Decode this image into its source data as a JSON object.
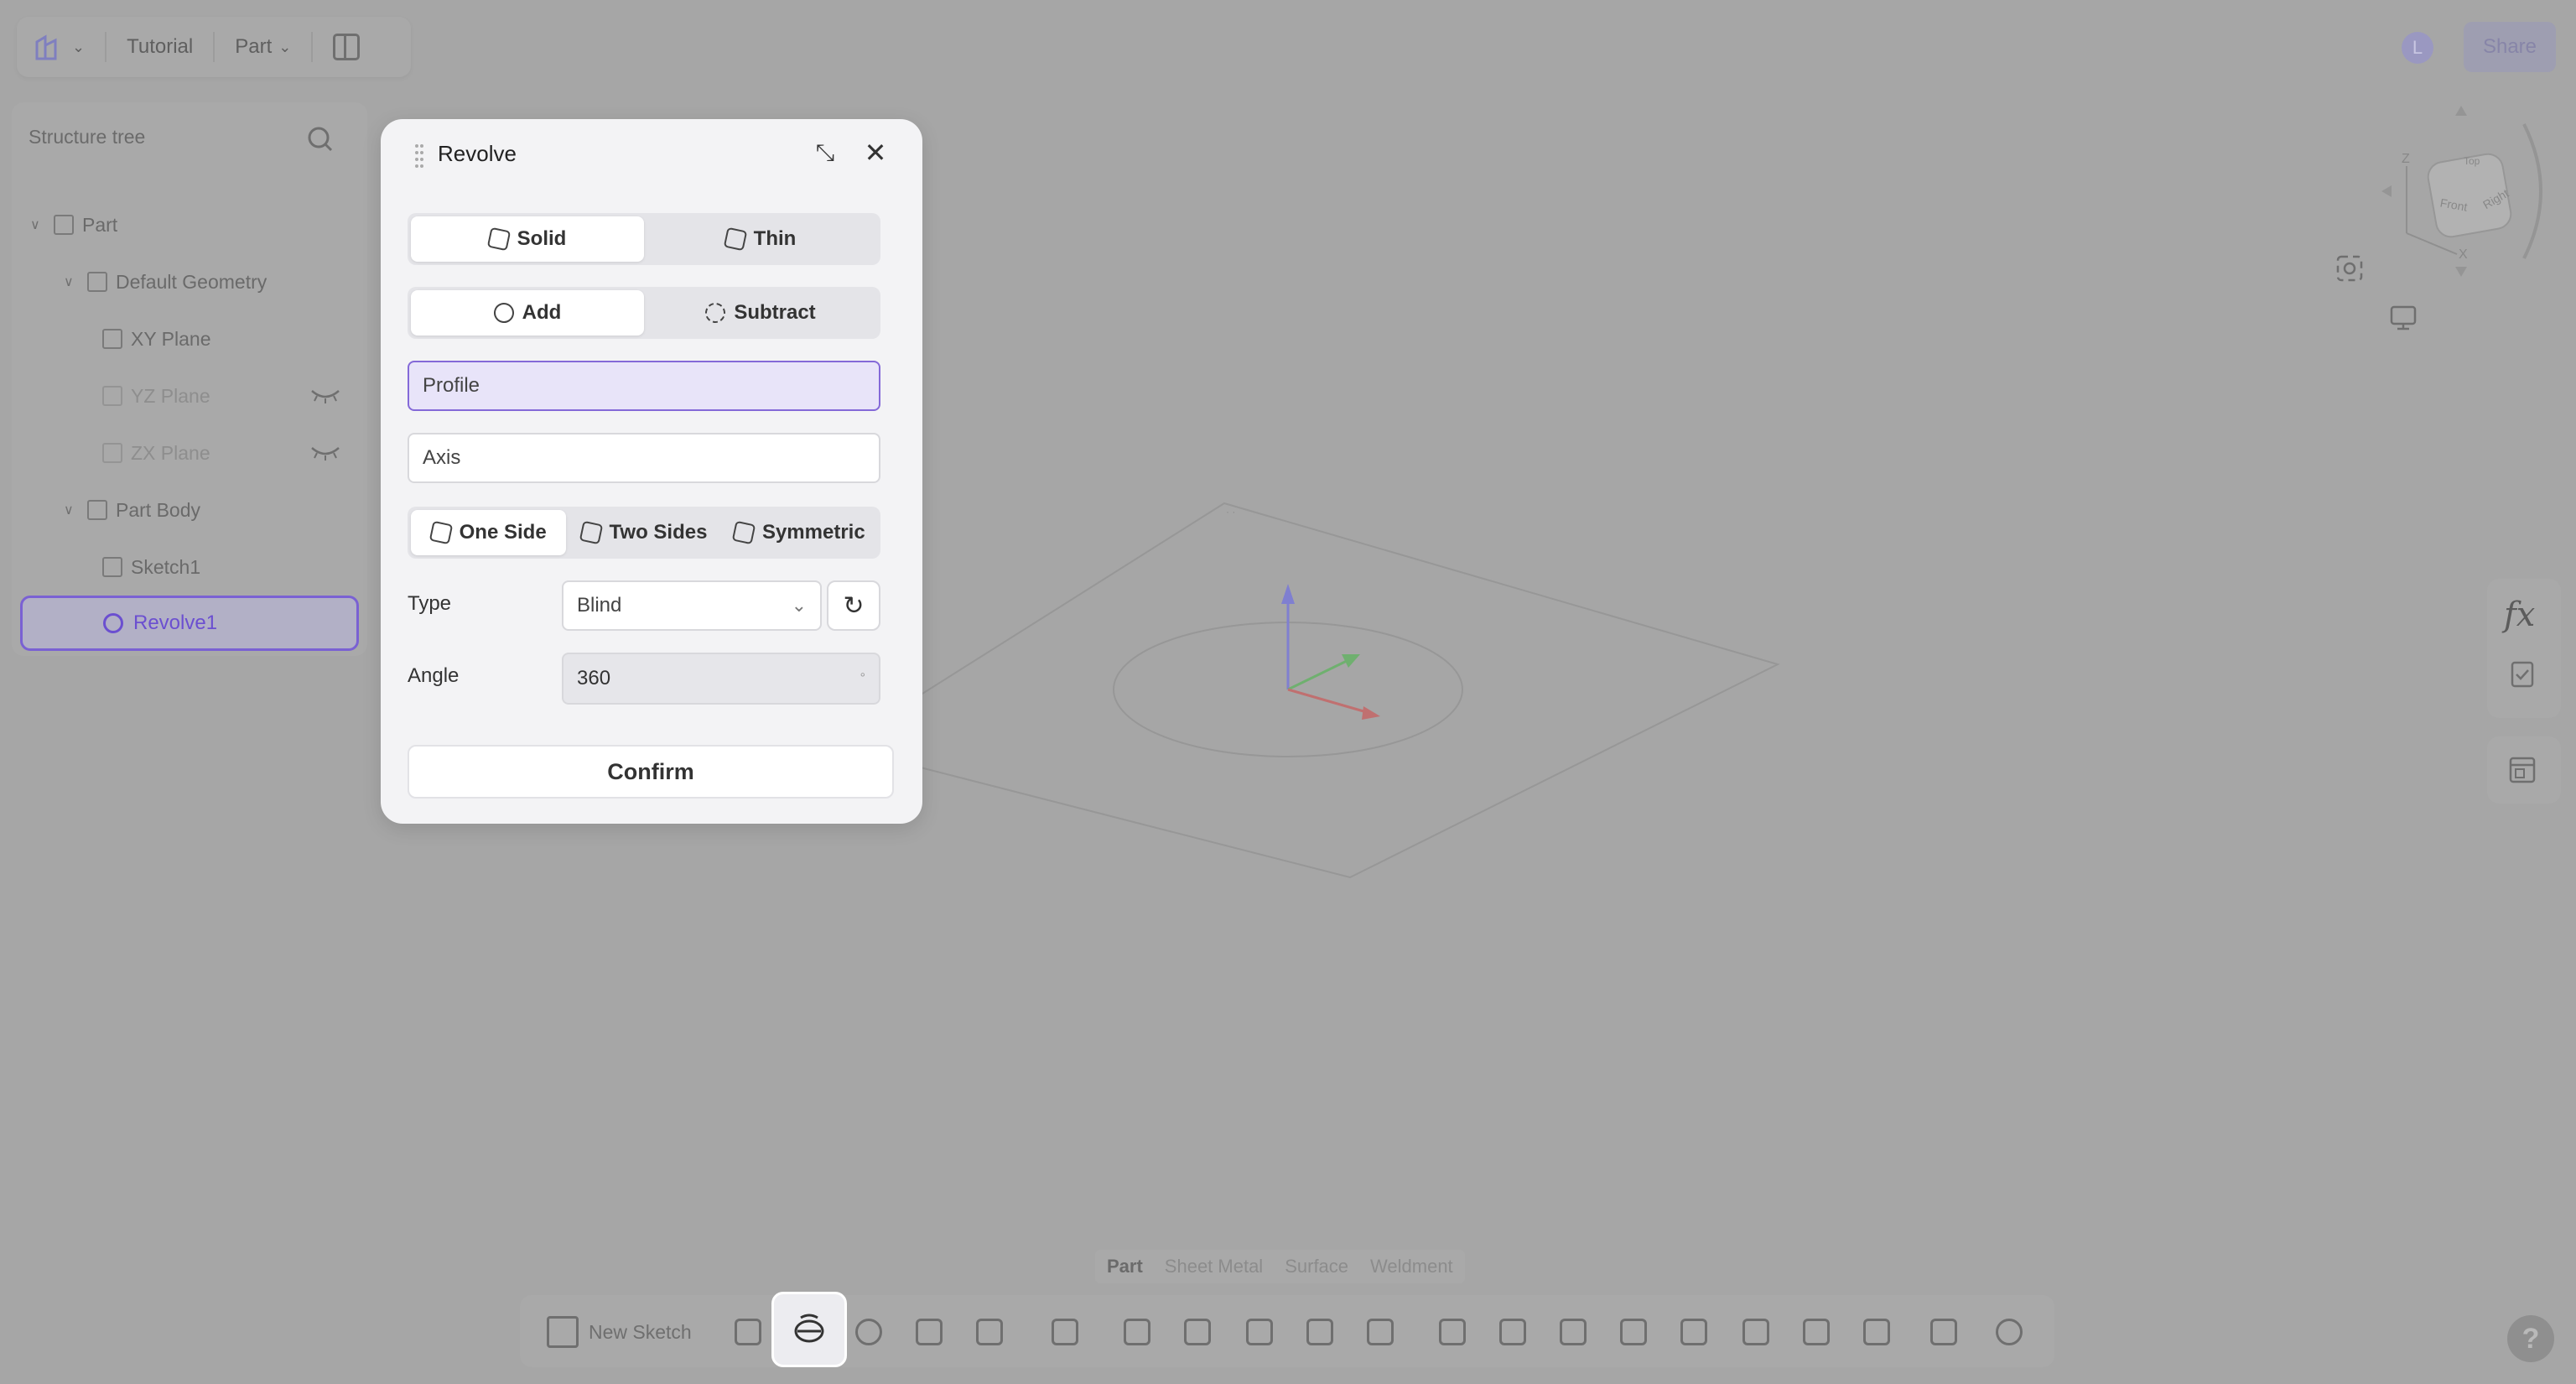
{
  "topbar": {
    "project": "Tutorial",
    "mode": "Part"
  },
  "user": {
    "avatar_initial": "L",
    "share_label": "Share"
  },
  "tree": {
    "header": "Structure tree",
    "items": [
      {
        "label": "Part",
        "level": 0,
        "expanded": true
      },
      {
        "label": "Default Geometry",
        "level": 1,
        "expanded": true
      },
      {
        "label": "XY Plane",
        "level": 2,
        "hidden": false
      },
      {
        "label": "YZ Plane",
        "level": 2,
        "hidden": true
      },
      {
        "label": "ZX Plane",
        "level": 2,
        "hidden": true
      },
      {
        "label": "Part Body",
        "level": 1,
        "expanded": true
      },
      {
        "label": "Sketch1",
        "level": 2
      },
      {
        "label": "Revolve1",
        "level": 2,
        "selected": true
      }
    ]
  },
  "dialog": {
    "title": "Revolve",
    "body_type": {
      "options": [
        "Solid",
        "Thin"
      ],
      "selected": "Solid"
    },
    "operation": {
      "options": [
        "Add",
        "Subtract"
      ],
      "selected": "Add"
    },
    "profile_placeholder": "Profile",
    "axis_placeholder": "Axis",
    "direction": {
      "options": [
        "One Side",
        "Two Sides",
        "Symmetric"
      ],
      "selected": "One Side"
    },
    "type_label": "Type",
    "type_value": "Blind",
    "angle_label": "Angle",
    "angle_value": "360",
    "angle_unit": "°",
    "confirm_label": "Confirm"
  },
  "viewcube": {
    "faces": [
      "Front",
      "Right",
      "Top"
    ],
    "axes": [
      "Z",
      "X"
    ]
  },
  "right_tools": {
    "fx_label": "fx"
  },
  "bottom": {
    "mode_tabs": [
      "Part",
      "Sheet Metal",
      "Surface",
      "Weldment"
    ],
    "active_mode": "Part",
    "new_sketch_label": "New Sketch",
    "active_tool": "revolve"
  },
  "help_label": "?",
  "colors": {
    "accent": "#7a61d3",
    "viewport_bg": "#a6a6a6",
    "dialog_bg": "#f3f3f5"
  }
}
